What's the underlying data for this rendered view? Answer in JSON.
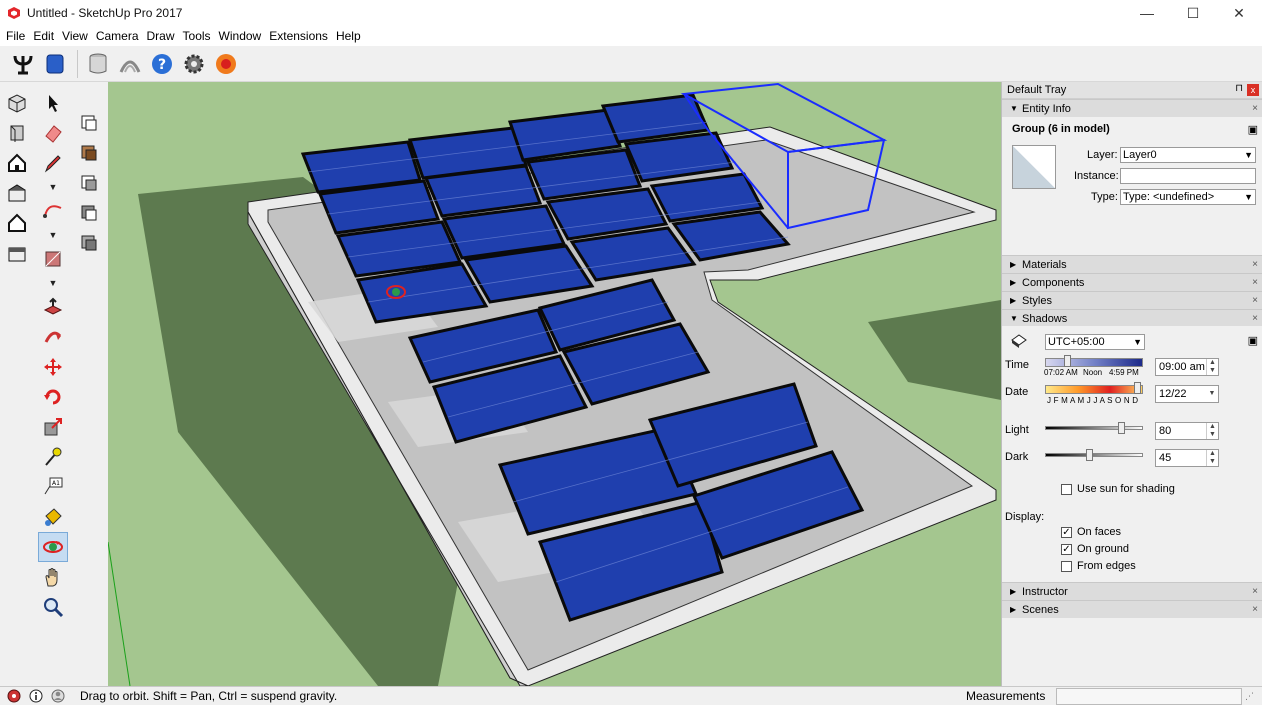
{
  "window": {
    "title": "Untitled - SketchUp Pro 2017",
    "minimize": "—",
    "maximize": "☐",
    "close": "✕"
  },
  "menu": [
    "File",
    "Edit",
    "View",
    "Camera",
    "Draw",
    "Tools",
    "Window",
    "Extensions",
    "Help"
  ],
  "toolbar_icons": [
    "sandbox-icon",
    "blue-solid-icon",
    "warehouse-icon",
    "extension-warehouse-icon",
    "help-icon",
    "settings-icon",
    "ruby-icon"
  ],
  "tray": {
    "title": "Default Tray",
    "pin": "⊓",
    "close": "x",
    "entity_info": {
      "header": "Entity Info",
      "selection": "Group (6 in model)",
      "layer_label": "Layer:",
      "layer_value": "Layer0",
      "instance_label": "Instance:",
      "instance_value": "",
      "type_label": "Type:",
      "type_value": "Type: <undefined>"
    },
    "panels_collapsed": [
      "Materials",
      "Components",
      "Styles"
    ],
    "shadows": {
      "header": "Shadows",
      "timezone": "UTC+05:00",
      "time_label": "Time",
      "time_start": "07:02 AM",
      "time_noon": "Noon",
      "time_end": "4:59 PM",
      "time_value": "09:00 am",
      "date_label": "Date",
      "months": "J F M A M J J A S O N D",
      "date_value": "12/22",
      "light_label": "Light",
      "light_value": "80",
      "light_level": 0.78,
      "dark_label": "Dark",
      "dark_value": "45",
      "dark_level": 0.45,
      "use_sun_label": "Use sun for shading",
      "use_sun_checked": false,
      "display_label": "Display:",
      "on_faces_label": "On faces",
      "on_faces_checked": true,
      "on_ground_label": "On ground",
      "on_ground_checked": true,
      "from_edges_label": "From edges",
      "from_edges_checked": false
    },
    "panels_bottom": [
      "Instructor",
      "Scenes"
    ]
  },
  "status": {
    "message": "Drag to orbit. Shift = Pan, Ctrl = suspend gravity.",
    "measurements_label": "Measurements",
    "measurements_value": ""
  },
  "colors": {
    "ground": "#a4c68f",
    "panel_blue": "#1f3fae",
    "selection": "#1a2cff",
    "roof": "#c4c4c4",
    "parapet": "#eaeaea"
  }
}
